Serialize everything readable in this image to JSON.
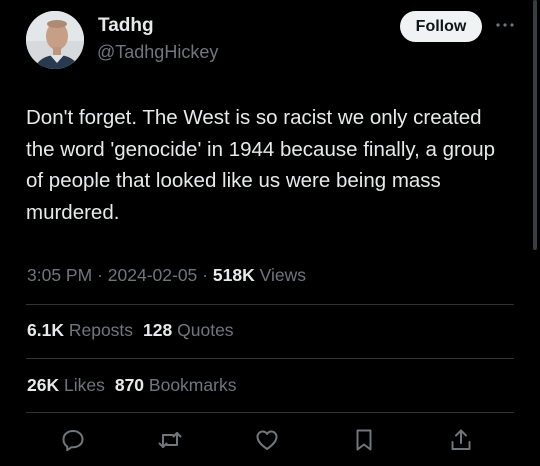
{
  "author": {
    "name": "Tadhg",
    "handle": "@TadhgHickey"
  },
  "follow_label": "Follow",
  "more_icon": "more-horizontal-icon",
  "tweet": {
    "text": "Don't forget. The West is so racist we only created the word 'genocide' in 1944 because finally, a group of people that looked like us were being mass murdered."
  },
  "meta": {
    "time": "3:05 PM",
    "separator": "·",
    "date": "2024-02-05",
    "views_count": "518K",
    "views_label": "Views"
  },
  "stats": {
    "reposts_count": "6.1K",
    "reposts_label": "Reposts",
    "quotes_count": "128",
    "quotes_label": "Quotes",
    "likes_count": "26K",
    "likes_label": "Likes",
    "bookmarks_count": "870",
    "bookmarks_label": "Bookmarks"
  },
  "actions": [
    "reply-icon",
    "repost-icon",
    "like-icon",
    "bookmark-icon",
    "share-icon"
  ],
  "colors": {
    "background": "#000000",
    "primary_text": "#e7e9ea",
    "secondary_text": "#71767b",
    "divider": "#2f3336",
    "follow_button_bg": "#eff3f4"
  }
}
